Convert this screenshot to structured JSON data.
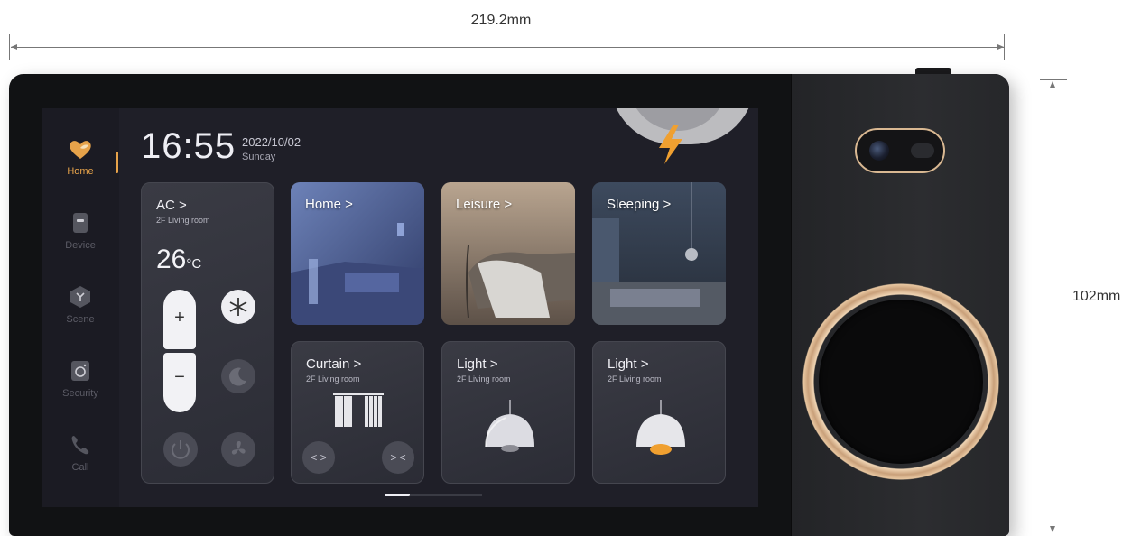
{
  "dimensions": {
    "width_label": "219.2mm",
    "height_label": "102mm"
  },
  "status": {
    "time": "16:55",
    "date": "2022/10/02",
    "weekday": "Sunday"
  },
  "nav": {
    "items": [
      {
        "label": "Home",
        "icon": "heart-icon",
        "active": true
      },
      {
        "label": "Device",
        "icon": "device-icon"
      },
      {
        "label": "Scene",
        "icon": "scene-icon"
      },
      {
        "label": "Security",
        "icon": "camera-icon"
      },
      {
        "label": "Call",
        "icon": "phone-icon"
      }
    ]
  },
  "ac": {
    "title": "AC  >",
    "room": "2F Living room",
    "temp": "26",
    "unit": "°C",
    "plus": "+",
    "minus": "−"
  },
  "scenes": [
    {
      "label": "Home >"
    },
    {
      "label": "Leisure >"
    },
    {
      "label": "Sleeping >"
    }
  ],
  "devices": [
    {
      "title": "Curtain >",
      "room": "2F Living room"
    },
    {
      "title": "Light >",
      "room": "2F Living room",
      "on": false
    },
    {
      "title": "Light >",
      "room": "2F Living room",
      "on": true
    }
  ],
  "curtain_controls": {
    "open": "< >",
    "close": "> <"
  },
  "colors": {
    "accent": "#e7a34a",
    "ring": "#e8c7a1",
    "lamp_on": "#f0a030"
  }
}
